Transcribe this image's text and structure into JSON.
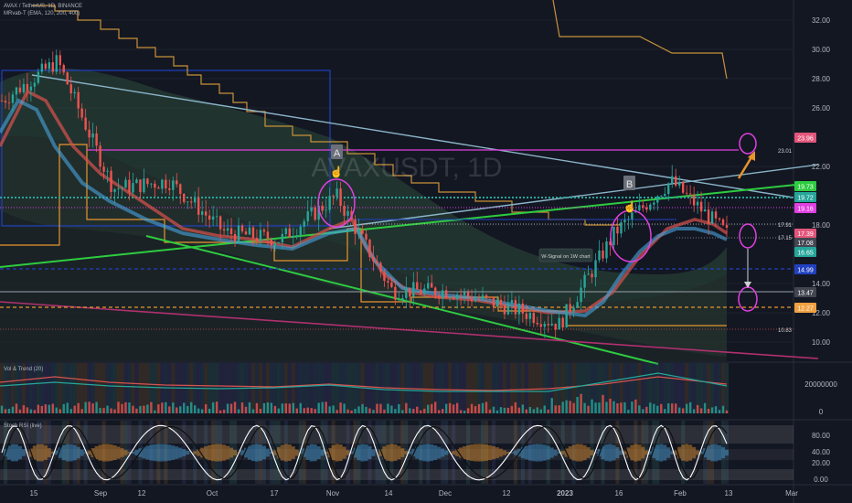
{
  "header": {
    "symbol_line": "AVAX / TetherUS, 1D, BINANCE",
    "indicator_line": "MRvab-T (EMA, 120, 200, 400)"
  },
  "watermark": "AVAXUSDT, 1D",
  "colors": {
    "background": "#131722",
    "candle_up": "#26a69a",
    "candle_down": "#ef5350",
    "trendline_green": "#2ecc40",
    "magenta": "#e040e0",
    "orange": "#f0a040",
    "blue": "#2040c0",
    "red_band": "#d9534f",
    "cyan_band": "#4aa3df"
  },
  "annotations": {
    "label_a": "A",
    "label_b": "B",
    "signal_note": "W-Signal on 1W chart"
  },
  "price_axis": {
    "ticks": [
      "32.00",
      "30.00",
      "28.00",
      "26.00",
      "22.00",
      "18.00",
      "14.00",
      "12.00",
      "10.00"
    ],
    "level_labels": [
      "23.01",
      "17.91",
      "17.15",
      "10.83"
    ],
    "badges": [
      {
        "text": "23.96",
        "color": "#e2557a"
      },
      {
        "text": "19.73",
        "color": "#2ecc40"
      },
      {
        "text": "19.72",
        "color": "#26a69a"
      },
      {
        "text": "19.16",
        "color": "#e040e0"
      },
      {
        "text": "17.39",
        "color": "#e2557a"
      },
      {
        "text": "17.08",
        "color": "#434651"
      },
      {
        "text": "16.65",
        "color": "#26a69a"
      },
      {
        "text": "14.99",
        "color": "#2040c0"
      },
      {
        "text": "13.47",
        "color": "#434651"
      },
      {
        "text": "12.27",
        "color": "#f0a040"
      }
    ]
  },
  "volume_pane": {
    "label": "Vol & Trend (20)",
    "ticks": [
      "20000000",
      "0"
    ]
  },
  "stoch_pane": {
    "label": "Stoch RSI (live)",
    "ticks": [
      "80.00",
      "40.00",
      "20.00",
      "0.00"
    ]
  },
  "time_axis": {
    "labels": [
      "15",
      "Sep",
      "12",
      "Oct",
      "17",
      "Nov",
      "14",
      "Dec",
      "12",
      "2023",
      "16",
      "Feb",
      "13",
      "Mar"
    ]
  },
  "chart_data": {
    "type": "candlestick",
    "title": "AVAXUSDT, 1D",
    "ylim": [
      9.5,
      33
    ],
    "key_levels": [
      23.01,
      19.73,
      19.16,
      17.91,
      17.15,
      14.99,
      13.47,
      12.27,
      10.83
    ],
    "approx_close_path": [
      {
        "date": "Aug",
        "close": 26.5
      },
      {
        "date": "Aug mid",
        "close": 29.2
      },
      {
        "date": "Sep",
        "close": 20.5
      },
      {
        "date": "Sep 12",
        "close": 21.0
      },
      {
        "date": "Oct",
        "close": 17.5
      },
      {
        "date": "Oct 17",
        "close": 17.0
      },
      {
        "date": "Nov",
        "close": 20.0
      },
      {
        "date": "Nov 14",
        "close": 13.5
      },
      {
        "date": "Dec",
        "close": 13.5
      },
      {
        "date": "Dec 12",
        "close": 12.5
      },
      {
        "date": "2023",
        "close": 11.2
      },
      {
        "date": "Jan 16",
        "close": 17.5
      },
      {
        "date": "Feb",
        "close": 21.0
      },
      {
        "date": "Feb 13",
        "close": 17.4
      }
    ]
  }
}
